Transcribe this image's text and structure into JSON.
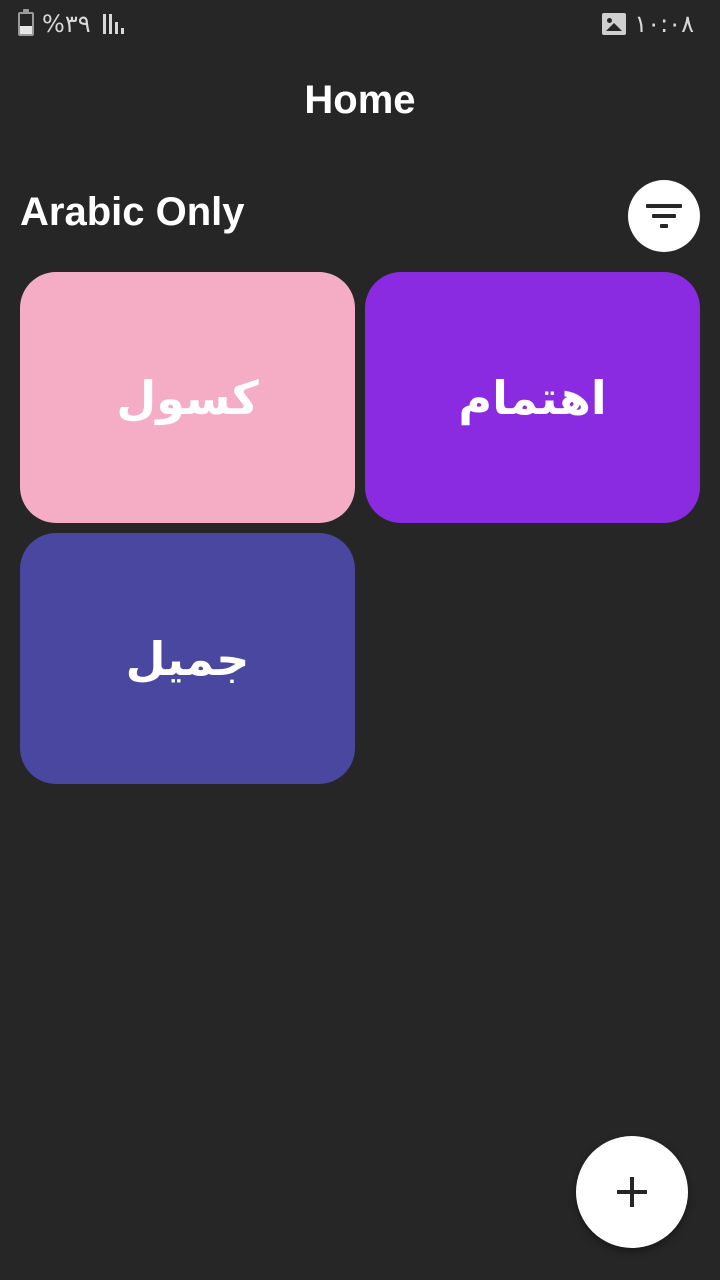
{
  "status_bar": {
    "battery_text": "%٣٩",
    "time": "١٠:٠٨",
    "battery_icon": "battery-icon",
    "signal_icon": "signal-icon",
    "gallery_icon": "image-icon"
  },
  "header": {
    "title": "Home"
  },
  "section": {
    "title": "Arabic Only",
    "filter_icon": "filter-icon"
  },
  "cards": [
    {
      "label": "كسول",
      "color": "#f4adc4"
    },
    {
      "label": "اهتمام",
      "color": "#8a2be2"
    },
    {
      "label": "جميل",
      "color": "#4a47a0"
    }
  ],
  "fab": {
    "icon": "plus-icon"
  },
  "colors": {
    "background": "#262626",
    "text": "#ffffff",
    "button_bg": "#ffffff"
  }
}
